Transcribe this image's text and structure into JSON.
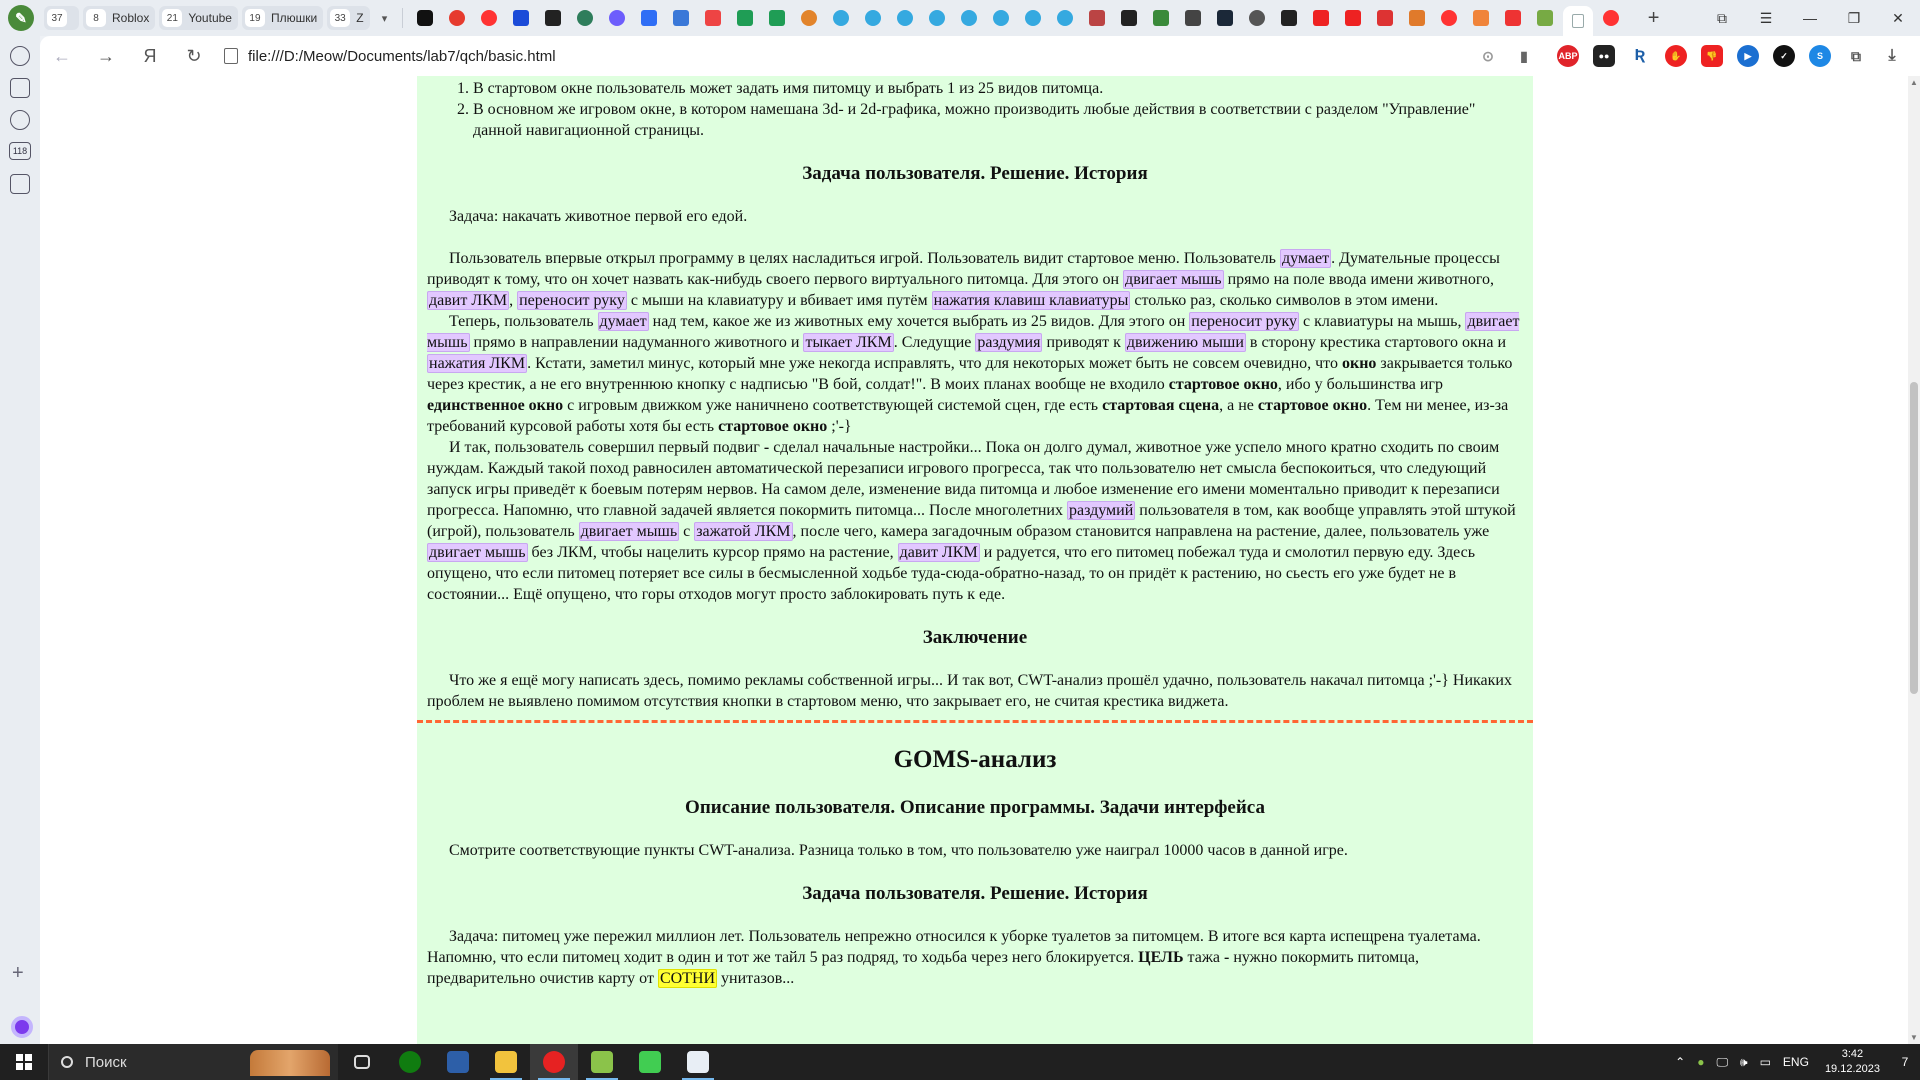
{
  "browser": {
    "tab_groups": [
      {
        "count": "37",
        "label": ""
      },
      {
        "count": "8",
        "label": "Roblox"
      },
      {
        "count": "21",
        "label": "Youtube"
      },
      {
        "count": "19",
        "label": "Плюшки"
      },
      {
        "count": "33",
        "label": "Z"
      }
    ],
    "url": "file:///D:/Meow/Documents/lab7/qch/basic.html",
    "colors": {
      "accent": "#4a8a3a",
      "column_bg": "#dfffdf",
      "highlight": "#e2c8ff",
      "highlight_yellow": "#ffff33",
      "divider": "#ff6633"
    }
  },
  "sidebar": {
    "badge": "118"
  },
  "page": {
    "list": [
      "В стартовом окне пользователь может задать имя питомцу и выбрать 1 из 25 видов питомца.",
      "В основном же игровом окне, в котором намешана 3d- и 2d-графика, можно производить любые действия в соответствии с разделом \"Управление\" данной навигационной страницы."
    ],
    "h_task1": "Задача пользователя. Решение. История",
    "task1": "Задача: накачать животное первой его едой.",
    "p1": [
      {
        "t": "Пользователь впервые открыл программу в целях насладиться игрой. Пользователь видит стартовое меню. Пользователь "
      },
      {
        "t": "думает",
        "hl": 1
      },
      {
        "t": ". Думательные процессы приводят к тому, что он хочет назвать как-нибудь своего первого виртуального питомца. Для этого он "
      },
      {
        "t": "двигает мышь",
        "hl": 1
      },
      {
        "t": " прямо на поле ввода имени животного, "
      },
      {
        "t": "давит ЛКМ",
        "hl": 1
      },
      {
        "t": ", "
      },
      {
        "t": "переносит руку",
        "hl": 1
      },
      {
        "t": " с мыши на клавиатуру и вбивает имя путём "
      },
      {
        "t": "нажатия клавиш клавиатуры",
        "hl": 1
      },
      {
        "t": " столько раз, сколько символов в этом имени."
      }
    ],
    "p2": [
      {
        "t": "Теперь, пользователь "
      },
      {
        "t": "думает",
        "hl": 1
      },
      {
        "t": " над тем, какое же из животных ему хочется выбрать из 25 видов. Для этого он "
      },
      {
        "t": "переносит руку",
        "hl": 1
      },
      {
        "t": " с клавиатуры на мышь, "
      },
      {
        "t": "двигает мышь",
        "hl": 1
      },
      {
        "t": " прямо в направлении надуманного животного и "
      },
      {
        "t": "тыкает ЛКМ",
        "hl": 1
      },
      {
        "t": ". Следущие "
      },
      {
        "t": "раздумия",
        "hl": 1
      },
      {
        "t": " приводят к "
      },
      {
        "t": "движению мыши",
        "hl": 1
      },
      {
        "t": " в сторону крестика стартового окна и "
      },
      {
        "t": "нажатия ЛКМ",
        "hl": 1
      },
      {
        "t": ". Кстати, заметил минус, который мне уже некогда исправлять, что для некоторых может быть не совсем очевидно, что "
      },
      {
        "t": "окно",
        "b": 1
      },
      {
        "t": " закрывается только через крестик, а не его внутреннюю кнопку с надписью \"В бой, солдат!\". В моих планах вообще не входило "
      },
      {
        "t": "стартовое окно",
        "b": 1
      },
      {
        "t": ", ибо у большинства игр "
      },
      {
        "t": "единственное окно",
        "b": 1
      },
      {
        "t": " с игровым движком уже наничнено соответствующей системой сцен, где есть "
      },
      {
        "t": "стартовая сцена",
        "b": 1
      },
      {
        "t": ", а не "
      },
      {
        "t": "стартовое окно",
        "b": 1
      },
      {
        "t": ". Тем ни менее, из-за требований курсовой работы хотя бы есть "
      },
      {
        "t": "стартовое окно",
        "b": 1
      },
      {
        "t": " ;'-}"
      }
    ],
    "p3": [
      {
        "t": "И так, пользователь совершил первый подвиг "
      },
      {
        "t": "-",
        "b": 1
      },
      {
        "t": " сделал начальные настройки... Пока он долго думал, животное уже успело много кратно сходить по своим нуждам. Каждый такой поход равносилен автоматической перезаписи игрового прогресса, так что пользователю нет смысла беспокоиться, что следующий запуск игры приведёт к боевым потерям нервов. На самом деле, изменение вида питомца и любое изменение его имени моментально приводит к перезаписи прогресса. Напомню, что главной задачей является покормить питомца... После многолетних "
      },
      {
        "t": "раздумий",
        "hl": 1
      },
      {
        "t": " пользователя в том, как вообще управлять этой штукой (игрой), пользователь "
      },
      {
        "t": "двигает мышь",
        "hl": 1
      },
      {
        "t": " с "
      },
      {
        "t": "зажатой ЛКМ",
        "hl": 1
      },
      {
        "t": ", после чего, камера загадочным образом становится направлена на растение, далее, пользователь уже "
      },
      {
        "t": "двигает мышь",
        "hl": 1
      },
      {
        "t": " без ЛКМ, чтобы нацелить курсор прямо на растение, "
      },
      {
        "t": "давит ЛКМ",
        "hl": 1
      },
      {
        "t": " и радуется, что его питомец побежал туда и смолотил первую еду. Здесь опущено, что если питомец потеряет все силы в бесмысленной ходьбе туда-сюда-обратно-назад, то он придёт к растению, но сьесть его уже будет не в состоянии... Ещё опущено, что горы отходов могут просто заблокировать путь к еде."
      }
    ],
    "h_conclusion": "Заключение",
    "conclusion": "Что же я ещё могу написать здесь, помимо рекламы собственной игры... И так вот, CWT-анализ прошёл удачно, пользователь накачал питомца ;'-} Никаких проблем не выявлено помимом отсутствия кнопки в стартовом меню, что закрывает его, не считая крестика виджета.",
    "h_goms": "GOMS-анализ",
    "h_goms_desc": "Описание пользователя. Описание программы. Задачи интерфейса",
    "goms_desc": "Смотрите соответствующие пункты CWT-анализа. Разница только в том, что пользователю уже наиграл 10000 часов в данной игре.",
    "h_task2": "Задача пользователя. Решение. История",
    "task2": [
      {
        "t": "Задача: питомец уже пережил миллион лет. Пользователь непрежно относился к уборке туалетов за питомцем. В итоге вся карта испещрена туалетама. Напомню, что если питомец ходит в один и тот же тайл 5 раз подряд, то ходьба через него блокируется. "
      },
      {
        "t": "ЦЕЛЬ",
        "b": 1
      },
      {
        "t": " тажа "
      },
      {
        "t": "-",
        "b": 1
      },
      {
        "t": " нужно покормить питомца, предварительно очистив карту от "
      },
      {
        "t": "СОТНИ",
        "y": 1
      },
      {
        "t": " унитазов..."
      }
    ]
  },
  "taskbar": {
    "search_placeholder": "Поиск",
    "lang": "ENG",
    "time": "3:42",
    "date": "19.12.2023",
    "notifications": "7"
  }
}
